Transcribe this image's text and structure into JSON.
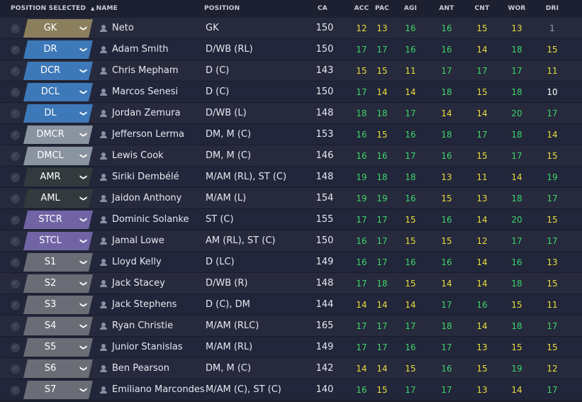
{
  "colors": {
    "header_bg": "#1d2030",
    "row_odd": "#262a3c",
    "row_even": "#22263a",
    "attr_high": "#3ed46a",
    "attr_mid": "#e9dd3c",
    "attr_base": "#ffffff",
    "attr_low": "#9a9ea8",
    "pos_gk": "#8c7f5e",
    "pos_def": "#3d78b8",
    "pos_dm": "#8a93a0",
    "pos_am": "#333a3d",
    "pos_st": "#7164a4",
    "pos_sub": "#6b6d76"
  },
  "headers": {
    "position_selected": "POSITION SELECTED",
    "sort_icon": "▲",
    "name": "NAME",
    "position": "POSITION",
    "ca": "CA",
    "acc": "ACC",
    "pac": "PAC",
    "agi": "AGI",
    "ant": "ANT",
    "cnt": "CNT",
    "wor": "WOR",
    "dri": "DRI"
  },
  "icons": {
    "check": "✓",
    "chevron": "❯",
    "row_check_icon": "check-circle-icon",
    "dropdown_icon": "chevron-down-icon",
    "player_icon": "person-icon"
  },
  "rows": [
    {
      "slot": "GK",
      "group": "gk",
      "name": "Neto",
      "position": "GK",
      "ca": "150",
      "acc": "12",
      "pac": "13",
      "agi": "16",
      "ant": "16",
      "cnt": "15",
      "wor": "13",
      "dri": "1"
    },
    {
      "slot": "DR",
      "group": "def",
      "name": "Adam Smith",
      "position": "D/WB (RL)",
      "ca": "150",
      "acc": "17",
      "pac": "17",
      "agi": "16",
      "ant": "16",
      "cnt": "14",
      "wor": "18",
      "dri": "15"
    },
    {
      "slot": "DCR",
      "group": "def",
      "name": "Chris Mepham",
      "position": "D (C)",
      "ca": "143",
      "acc": "15",
      "pac": "15",
      "agi": "11",
      "ant": "17",
      "cnt": "17",
      "wor": "17",
      "dri": "11"
    },
    {
      "slot": "DCL",
      "group": "def",
      "name": "Marcos Senesi",
      "position": "D (C)",
      "ca": "150",
      "acc": "17",
      "pac": "14",
      "agi": "14",
      "ant": "18",
      "cnt": "15",
      "wor": "18",
      "dri": "10"
    },
    {
      "slot": "DL",
      "group": "def",
      "name": "Jordan Zemura",
      "position": "D/WB (L)",
      "ca": "148",
      "acc": "18",
      "pac": "18",
      "agi": "17",
      "ant": "14",
      "cnt": "14",
      "wor": "20",
      "dri": "17"
    },
    {
      "slot": "DMCR",
      "group": "dm",
      "name": "Jefferson Lerma",
      "position": "DM, M (C)",
      "ca": "153",
      "acc": "16",
      "pac": "15",
      "agi": "16",
      "ant": "18",
      "cnt": "17",
      "wor": "18",
      "dri": "14"
    },
    {
      "slot": "DMCL",
      "group": "dm",
      "name": "Lewis Cook",
      "position": "DM, M (C)",
      "ca": "146",
      "acc": "16",
      "pac": "16",
      "agi": "17",
      "ant": "16",
      "cnt": "15",
      "wor": "17",
      "dri": "15"
    },
    {
      "slot": "AMR",
      "group": "am",
      "name": "Siriki Dembélé",
      "position": "M/AM (RL), ST (C)",
      "ca": "148",
      "acc": "19",
      "pac": "18",
      "agi": "18",
      "ant": "13",
      "cnt": "11",
      "wor": "14",
      "dri": "19"
    },
    {
      "slot": "AML",
      "group": "am",
      "name": "Jaidon Anthony",
      "position": "M/AM (L)",
      "ca": "154",
      "acc": "19",
      "pac": "19",
      "agi": "16",
      "ant": "15",
      "cnt": "13",
      "wor": "18",
      "dri": "17"
    },
    {
      "slot": "STCR",
      "group": "st",
      "name": "Dominic Solanke",
      "position": "ST (C)",
      "ca": "155",
      "acc": "17",
      "pac": "17",
      "agi": "15",
      "ant": "16",
      "cnt": "14",
      "wor": "20",
      "dri": "15"
    },
    {
      "slot": "STCL",
      "group": "st",
      "name": "Jamal Lowe",
      "position": "AM (RL), ST (C)",
      "ca": "150",
      "acc": "16",
      "pac": "17",
      "agi": "15",
      "ant": "15",
      "cnt": "12",
      "wor": "17",
      "dri": "17"
    },
    {
      "slot": "S1",
      "group": "sub",
      "name": "Lloyd Kelly",
      "position": "D (LC)",
      "ca": "149",
      "acc": "16",
      "pac": "17",
      "agi": "16",
      "ant": "16",
      "cnt": "14",
      "wor": "16",
      "dri": "13"
    },
    {
      "slot": "S2",
      "group": "sub",
      "name": "Jack Stacey",
      "position": "D/WB (R)",
      "ca": "148",
      "acc": "17",
      "pac": "18",
      "agi": "15",
      "ant": "14",
      "cnt": "14",
      "wor": "18",
      "dri": "15"
    },
    {
      "slot": "S3",
      "group": "sub",
      "name": "Jack Stephens",
      "position": "D (C), DM",
      "ca": "144",
      "acc": "14",
      "pac": "14",
      "agi": "14",
      "ant": "17",
      "cnt": "16",
      "wor": "15",
      "dri": "11"
    },
    {
      "slot": "S4",
      "group": "sub",
      "name": "Ryan Christie",
      "position": "M/AM (RLC)",
      "ca": "165",
      "acc": "17",
      "pac": "17",
      "agi": "17",
      "ant": "18",
      "cnt": "14",
      "wor": "18",
      "dri": "17"
    },
    {
      "slot": "S5",
      "group": "sub",
      "name": "Junior Stanislas",
      "position": "M/AM (RL)",
      "ca": "149",
      "acc": "17",
      "pac": "17",
      "agi": "16",
      "ant": "17",
      "cnt": "13",
      "wor": "15",
      "dri": "15"
    },
    {
      "slot": "S6",
      "group": "sub",
      "name": "Ben Pearson",
      "position": "DM, M (C)",
      "ca": "142",
      "acc": "14",
      "pac": "14",
      "agi": "15",
      "ant": "16",
      "cnt": "15",
      "wor": "19",
      "dri": "12"
    },
    {
      "slot": "S7",
      "group": "sub",
      "name": "Emiliano Marcondes",
      "position": "M/AM (C), ST (C)",
      "ca": "140",
      "acc": "16",
      "pac": "15",
      "agi": "17",
      "ant": "17",
      "cnt": "13",
      "wor": "14",
      "dri": "17"
    }
  ]
}
